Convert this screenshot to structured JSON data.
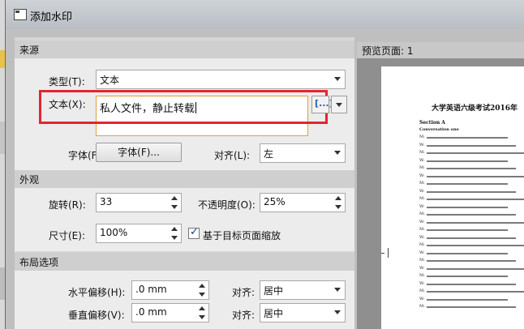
{
  "window": {
    "title": "添加水印"
  },
  "source": {
    "group_title": "来源",
    "type_label": "类型(T):",
    "type_value": "文本",
    "text_label": "文本(X):",
    "text_value": "私人文件，静止转载",
    "insert_button_label": "[...]",
    "font_label": "字体(F):",
    "font_button_label": "字体(F)...",
    "align_label": "对齐(L):",
    "align_value": "左"
  },
  "appearance": {
    "group_title": "外观",
    "rotate_label": "旋转(R):",
    "rotate_value": "33",
    "opacity_label": "不透明度(O):",
    "opacity_value": "25%",
    "size_label": "尺寸(E):",
    "size_value": "100%",
    "scale_checkbox_label": "基于目标页面缩放",
    "scale_checked": true
  },
  "layout": {
    "group_title": "布局选项",
    "h_offset_label": "水平偏移(H):",
    "h_offset_value": ".0 mm",
    "h_align_label": "对齐:",
    "h_align_value": "居中",
    "v_offset_label": "垂直偏移(V):",
    "v_offset_value": ".0 mm",
    "v_align_label": "对齐:",
    "v_align_value": "居中"
  },
  "preview": {
    "header": "预览页面: 1",
    "doc_title": "大学英语六级考试2016年",
    "section": "Section A",
    "subsection": "Conversation one",
    "speaker_marks": [
      "M:",
      "W:",
      "M:",
      "W:",
      "M:",
      "W:",
      "M:",
      "W:",
      "M:",
      "W:",
      "M:",
      "W:",
      "M:",
      "W:",
      "M:",
      "W:",
      "M:",
      "W:",
      "M:",
      "W:",
      "M:",
      "W:",
      "M:"
    ]
  },
  "colors": {
    "highlight": "#e3262e",
    "accent": "#1f5fbf"
  }
}
